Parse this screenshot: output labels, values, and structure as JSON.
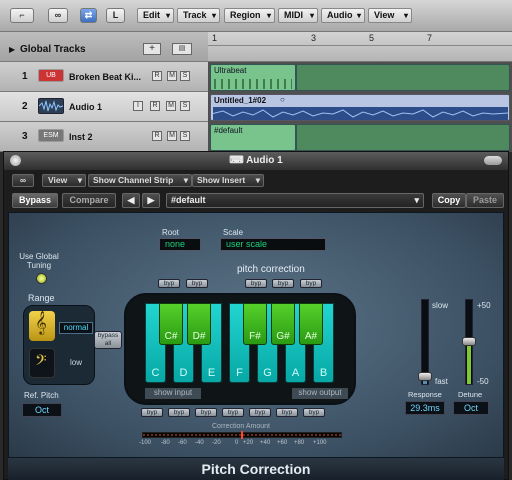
{
  "toolbar": {
    "buttons": [
      "L",
      "H"
    ],
    "menus": [
      "Edit",
      "Track",
      "Region",
      "MIDI",
      "Audio",
      "View"
    ]
  },
  "tracks": {
    "global_label": "Global Tracks",
    "ruler": [
      "1",
      "3",
      "5",
      "7"
    ],
    "rows": [
      {
        "num": "1",
        "icon": "UB",
        "name": "Broken Beat Ki...",
        "region": "Ultrabeat"
      },
      {
        "num": "2",
        "icon": "",
        "name": "Audio 1",
        "region": "Untitled_1#02"
      },
      {
        "num": "3",
        "icon": "ESM",
        "name": "Inst 2",
        "region": "#default"
      }
    ],
    "mute_solo": [
      "R",
      "M",
      "S"
    ],
    "audio_buttons": [
      "I",
      "R",
      "M",
      "S"
    ]
  },
  "plugin": {
    "window_title": "Audio 1",
    "view_menu": "View",
    "channel_strip_menu": "Show Channel Strip",
    "insert_menu": "Show Insert",
    "bypass": "Bypass",
    "compare": "Compare",
    "preset": "#default",
    "copy": "Copy",
    "paste": "Paste"
  },
  "pitch": {
    "use_global_tuning": "Use Global Tuning",
    "root_label": "Root",
    "root_value": "none",
    "scale_label": "Scale",
    "scale_value": "user scale",
    "section_title": "pitch correction",
    "range_label": "Range",
    "range_normal": "normal",
    "range_low": "low",
    "bypass_all": "bypass all",
    "white_keys": [
      "C",
      "D",
      "E",
      "F",
      "G",
      "A",
      "B"
    ],
    "black_keys": [
      "C#",
      "D#",
      "F#",
      "G#",
      "A#"
    ],
    "byp": "byp",
    "show_input": "show input",
    "show_output": "show output",
    "ref_pitch_label": "Ref. Pitch",
    "ref_pitch_value": "Oct",
    "correction_amount_label": "Correction Amount",
    "correction_scale": [
      "-100",
      "-80",
      "-60",
      "-40",
      "-20",
      "0",
      "+20",
      "+40",
      "+60",
      "+80",
      "+100"
    ],
    "slow": "slow",
    "fast": "fast",
    "response_label": "Response",
    "response_value": "29.3ms",
    "detune_label": "Detune",
    "detune_value": "Oct",
    "detune_top": "+50",
    "detune_bottom": "-50",
    "plugin_name": "Pitch Correction",
    "response_level": 0.08,
    "detune_level": 0.5
  }
}
